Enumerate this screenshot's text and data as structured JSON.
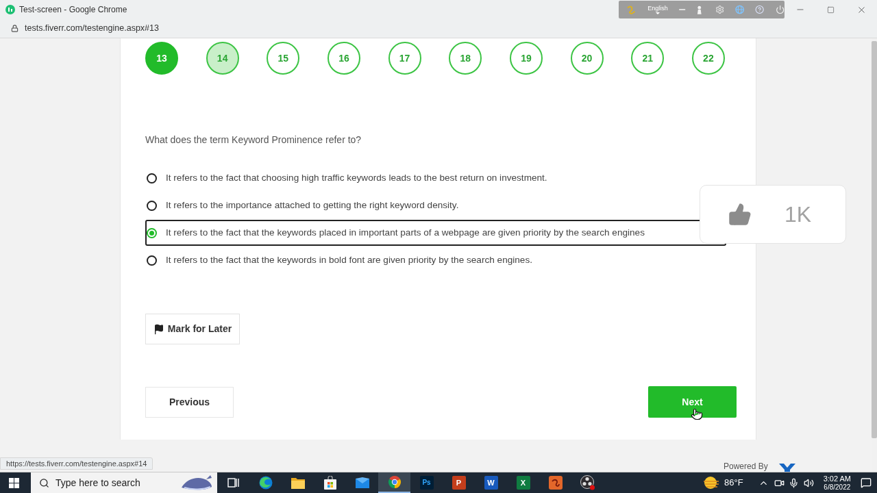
{
  "window": {
    "title": "Test-screen - Google Chrome"
  },
  "language_bar": {
    "language": "English"
  },
  "address_bar": {
    "url": "tests.fiverr.com/testengine.aspx#13"
  },
  "question_nav": [
    {
      "label": "13",
      "selected": true,
      "highlighted": false
    },
    {
      "label": "14",
      "selected": false,
      "highlighted": true
    },
    {
      "label": "15",
      "selected": false,
      "highlighted": false
    },
    {
      "label": "16",
      "selected": false,
      "highlighted": false
    },
    {
      "label": "17",
      "selected": false,
      "highlighted": false
    },
    {
      "label": "18",
      "selected": false,
      "highlighted": false
    },
    {
      "label": "19",
      "selected": false,
      "highlighted": false
    },
    {
      "label": "20",
      "selected": false,
      "highlighted": false
    },
    {
      "label": "21",
      "selected": false,
      "highlighted": false
    },
    {
      "label": "22",
      "selected": false,
      "highlighted": false
    }
  ],
  "question": {
    "text": "What does the term Keyword Prominence refer to?",
    "options": [
      {
        "text": "It refers to the fact that choosing high traffic keywords leads to the best return on investment.",
        "selected": false
      },
      {
        "text": "It refers to the importance attached to getting the right keyword density.",
        "selected": false
      },
      {
        "text": "It refers to the fact that the keywords placed in important parts of a webpage are given priority by the search engines",
        "selected": true
      },
      {
        "text": "It refers to the fact that the keywords in bold font are given priority by the search engines.",
        "selected": false
      }
    ]
  },
  "mark_button": {
    "label": "Mark for Later"
  },
  "previous_button": {
    "label": "Previous"
  },
  "next_button": {
    "label": "Next"
  },
  "like_overlay": {
    "count": "1K"
  },
  "status_link": "https://tests.fiverr.com/testengine.aspx#14",
  "footer": {
    "powered_by": "Powered By"
  },
  "taskbar": {
    "search": {
      "placeholder": "Type here to search"
    },
    "apps": [
      {
        "kind": "task-view",
        "selected": false
      },
      {
        "kind": "edge",
        "selected": false
      },
      {
        "kind": "folder",
        "selected": false
      },
      {
        "kind": "store",
        "selected": false
      },
      {
        "kind": "mail",
        "selected": false
      },
      {
        "kind": "chrome",
        "selected": true
      },
      {
        "kind": "photoshop",
        "glyph": "Ps",
        "selected": false
      },
      {
        "kind": "powerpoint",
        "glyph": "P",
        "selected": false
      },
      {
        "kind": "word",
        "glyph": "W",
        "selected": false
      },
      {
        "kind": "excel",
        "glyph": "X",
        "selected": false
      },
      {
        "kind": "script-app",
        "selected": false
      },
      {
        "kind": "recorder",
        "selected": false
      }
    ],
    "weather": "86°F",
    "time": "3:02 AM",
    "date": "6/8/2022"
  }
}
